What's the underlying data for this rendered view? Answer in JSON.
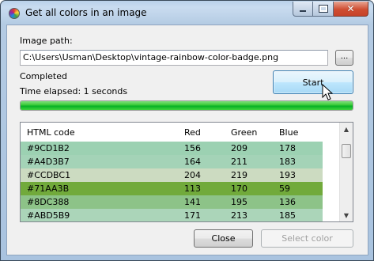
{
  "window": {
    "title": "Get all colors in an image",
    "close_glyph": "✕"
  },
  "form": {
    "image_path_label": "Image path:",
    "image_path_value": "C:\\Users\\Usman\\Desktop\\vintage-rainbow-color-badge.png",
    "browse_label": "...",
    "start_label": "Start",
    "status_text": "Completed",
    "time_elapsed_text": "Time elapsed: 1 seconds",
    "progress_percent": 100,
    "progress_color": "#06b025"
  },
  "table": {
    "columns": [
      "HTML code",
      "Red",
      "Green",
      "Blue"
    ],
    "rows": [
      {
        "code": "#9CD1B2",
        "red": "156",
        "green": "209",
        "blue": "178",
        "color": "#9CD1B2"
      },
      {
        "code": "#A4D3B7",
        "red": "164",
        "green": "211",
        "blue": "183",
        "color": "#A4D3B7"
      },
      {
        "code": "#CCDBC1",
        "red": "204",
        "green": "219",
        "blue": "193",
        "color": "#CCDBC1"
      },
      {
        "code": "#71AA3B",
        "red": "113",
        "green": "170",
        "blue": "59",
        "color": "#71AA3B"
      },
      {
        "code": "#8DC388",
        "red": "141",
        "green": "195",
        "blue": "136",
        "color": "#8DC388"
      },
      {
        "code": "#ABD5B9",
        "red": "171",
        "green": "213",
        "blue": "185",
        "color": "#ABD5B9"
      }
    ]
  },
  "footer": {
    "close_label": "Close",
    "select_color_label": "Select color"
  }
}
